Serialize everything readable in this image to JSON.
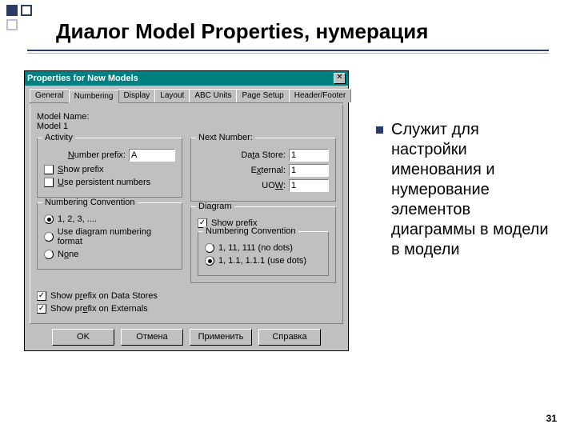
{
  "slide": {
    "title": "Диалог Model Properties, нумерация",
    "page_number": "31",
    "bullet_text": "Служит для настройки именования и нумерование элементов диаграммы в модели в модели"
  },
  "dialog": {
    "title": "Properties for New Models",
    "tabs": [
      "General",
      "Numbering",
      "Display",
      "Layout",
      "ABC Units",
      "Page Setup",
      "Header/Footer"
    ],
    "active_tab": "Numbering",
    "model_name_label": "Model Name:",
    "model_name_value": "Model 1",
    "activity": {
      "legend": "Activity",
      "number_prefix_label": "Number prefix:",
      "number_prefix_value": "A",
      "show_prefix": "Show prefix",
      "use_persistent": "Use persistent numbers"
    },
    "numbering_convention": {
      "legend": "Numbering Convention",
      "opt1": "1, 2, 3, ....",
      "opt2": "Use diagram numbering format",
      "opt3": "None"
    },
    "next_number": {
      "legend": "Next Number:",
      "data_store_label": "Data Store:",
      "data_store_value": "1",
      "external_label": "External:",
      "external_value": "1",
      "uow_label": "UOW:",
      "uow_value": "1"
    },
    "diagram": {
      "legend": "Diagram",
      "show_prefix": "Show prefix",
      "nc_legend": "Numbering Convention",
      "nc_opt1": "1, 11, 111 (no dots)",
      "nc_opt2": "1, 1.1, 1.1.1 (use dots)"
    },
    "bottom_checks": {
      "show_prefix_ds": "Show prefix on Data Stores",
      "show_prefix_ext": "Show prefix on Externals"
    },
    "buttons": {
      "ok": "OK",
      "cancel": "Отмена",
      "apply": "Применить",
      "help": "Справка"
    }
  }
}
